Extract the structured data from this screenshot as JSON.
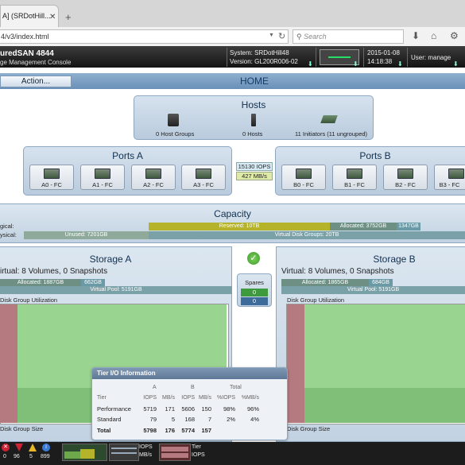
{
  "browser": {
    "tab_title": "A] (SRDotHill...",
    "url": "4/v3/index.html",
    "search_placeholder": "Search"
  },
  "header": {
    "product_name": "uredSAN 4844",
    "product_sub": "ge Management Console",
    "system_label": "System: SRDotHill48",
    "version_label": "Version: GL200R006-02",
    "date": "2015-01-08",
    "time": "14:18:38",
    "user": "User: manage"
  },
  "action_bar": {
    "action_label": "Action...",
    "page_title": "HOME"
  },
  "hosts": {
    "title": "Hosts",
    "host_groups": "0 Host Groups",
    "hosts": "0 Hosts",
    "initiators": "11 Initiators (11 ungrouped)"
  },
  "ports_a": {
    "title": "Ports A",
    "ports": [
      "A0 - FC",
      "A1 - FC",
      "A2 - FC",
      "A3 - FC"
    ]
  },
  "ports_b": {
    "title": "Ports B",
    "ports": [
      "B0 - FC",
      "B1 - FC",
      "B2 - FC",
      "B3 - FC"
    ]
  },
  "throughput": {
    "iops": "15130 IOPS",
    "mbs": "427 MB/s"
  },
  "capacity": {
    "title": "Capacity",
    "logical_label": "gical:",
    "physical_label": "ysical:",
    "reserved": "Reserved: 10TB",
    "allocated": "Allocated: 3752GB",
    "allocated_extra": "1347GB",
    "unused": "Unused: 7201GB",
    "vdisk_groups": "Virtual Disk Groups: 20TB"
  },
  "storage_a": {
    "title": "Storage A",
    "virtual": "irtual:  8 Volumes, 0 Snapshots",
    "allocated": "Allocated: 1887GB",
    "allocated_extra": "662GB",
    "pool": "Virtual Pool: 5191GB",
    "util_label": "Disk Group Utilization",
    "size_label": "Disk Group Size"
  },
  "storage_b": {
    "title": "Storage B",
    "virtual": "Virtual:  8 Volumes, 0 Snapshots",
    "allocated": "Allocated: 1865GB",
    "allocated_extra": "684GB",
    "pool": "Virtual Pool: 5191GB",
    "util_label": "Disk Group Utilization",
    "size_label": "Disk Group Size"
  },
  "spares": {
    "label": "Spares",
    "a": "0",
    "b": "0"
  },
  "tier_io": {
    "title": "Tier I/O Information",
    "group_a": "A",
    "group_b": "B",
    "group_total": "Total",
    "columns": [
      "Tier",
      "IOPS",
      "MB/s",
      "IOPS",
      "MB/s",
      "%IOPS",
      "%MB/s"
    ],
    "rows": [
      [
        "Performance",
        "5719",
        "171",
        "5606",
        "150",
        "98%",
        "96%"
      ],
      [
        "Standard",
        "79",
        "5",
        "168",
        "7",
        "2%",
        "4%"
      ],
      [
        "Total",
        "5798",
        "176",
        "5774",
        "157",
        "",
        ""
      ]
    ]
  },
  "bottom": {
    "errors": "0",
    "warnings": "96",
    "alerts": "5",
    "info": "899",
    "iops": "IOPS",
    "mbs": "MB/s",
    "tier": "Tier",
    "iops2": "IOPS"
  },
  "colors": {
    "reserved": "#b4b32a",
    "allocated": "#6d8f84",
    "unused": "#8fa99b",
    "vdisk": "#7aa0a8"
  }
}
